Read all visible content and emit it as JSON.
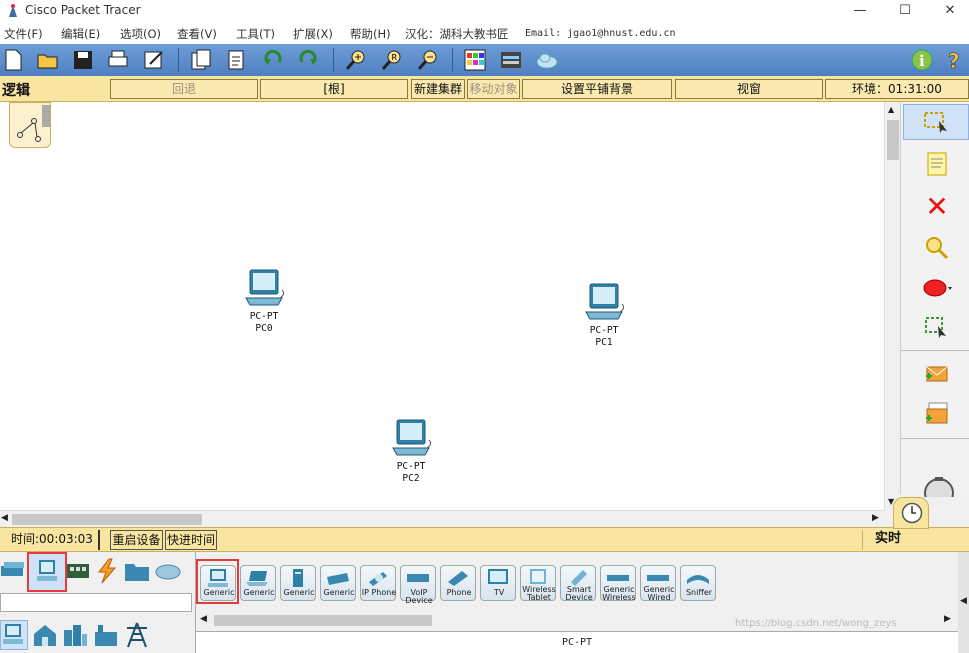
{
  "window": {
    "title": "Cisco Packet Tracer",
    "minimize": "—",
    "maximize": "☐",
    "close": "✕"
  },
  "menu": {
    "items": [
      "文件(F)",
      "编辑(E)",
      "选项(O)",
      "查看(V)",
      "工具(T)",
      "扩展(X)",
      "帮助(H)"
    ],
    "localized_by": "汉化：湖科大教书匠",
    "email": "Email: jgao1@hnust.edu.cn"
  },
  "toolbar": {
    "icons": [
      "new-icon",
      "open-icon",
      "save-icon",
      "print-icon",
      "activity-wizard-icon",
      "copy-icon",
      "paste-icon",
      "undo-icon",
      "redo-icon",
      "zoom-in-icon",
      "zoom-reset-icon",
      "zoom-out-icon",
      "palette-icon",
      "device-template-icon",
      "cloud-icon",
      "info-icon",
      "help-icon"
    ]
  },
  "logical_bar": {
    "label": "逻辑",
    "back": "回退",
    "root": "[根]",
    "new_cluster": "新建集群",
    "move_object": "移动对象",
    "set_background": "设置平铺背景",
    "viewport": "视窗",
    "environment": "环境：01:31:00"
  },
  "workspace": {
    "devices": [
      {
        "model": "PC-PT",
        "name": "PC0"
      },
      {
        "model": "PC-PT",
        "name": "PC1"
      },
      {
        "model": "PC-PT",
        "name": "PC2"
      }
    ]
  },
  "right_tools": [
    "select-icon",
    "note-icon",
    "delete-icon",
    "inspect-icon",
    "draw-ellipse-icon",
    "resize-icon",
    "add-simple-pdu-icon",
    "add-complex-pdu-icon"
  ],
  "time_bar": {
    "time": "时间:00:03:03",
    "restart": "重启设备",
    "fast_forward": "快进时间",
    "mode": "实时"
  },
  "device_list": {
    "items": [
      "Generic",
      "Generic",
      "Generic",
      "Generic",
      "Generic",
      "IP Phone",
      "VoIP Device",
      "Phone",
      "TV",
      "Wireless Tablet",
      "Smart Device",
      "Generic Wireless",
      "Generic Wired",
      "Sniffer"
    ],
    "selected_model": "PC-PT",
    "watermark": "https://blog.csdn.net/wong_zeys"
  },
  "colors": {
    "toolbar": "#5a8ccb",
    "logical_bar": "#f8e6a0",
    "pc": "#2f7fa6",
    "highlight": "#e53a3a"
  }
}
